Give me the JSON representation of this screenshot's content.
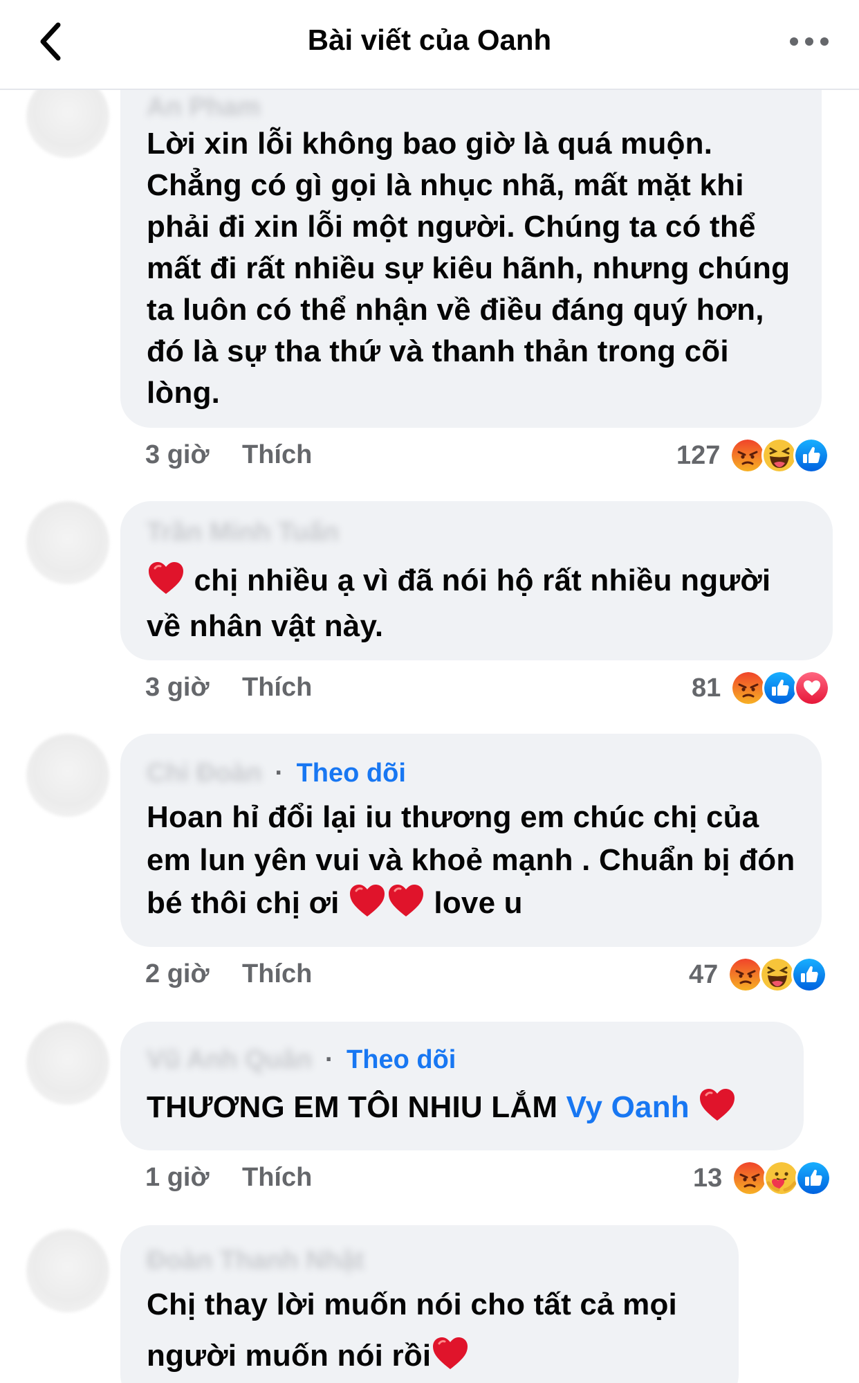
{
  "header": {
    "title": "Bài viết của Oanh"
  },
  "colors": {
    "link_blue": "#1877f2",
    "bubble_bg": "#f0f2f5",
    "meta_gray": "#65676b"
  },
  "comments": [
    {
      "author": "An Pham",
      "text": "Lời xin lỗi không bao giờ là quá muộn. Chẳng có gì gọi là nhục nhã, mất mặt khi phải đi xin lỗi một người. Chúng ta có thể mất đi rất nhiều sự kiêu hãnh, nhưng chúng ta luôn có thể nhận về điều đáng quý hơn, đó là sự tha thứ và thanh thản trong cõi lòng.",
      "time": "3 giờ",
      "like_label": "Thích",
      "reaction_count": "127",
      "reactions": [
        "angry-icon",
        "haha-icon",
        "like-icon"
      ]
    },
    {
      "author": "Trần Minh Tuấn",
      "text": "chị nhiều ạ vì đã nói hộ rất nhiều người về nhân vật này.",
      "time": "3 giờ",
      "like_label": "Thích",
      "reaction_count": "81",
      "reactions": [
        "angry-icon",
        "like-icon",
        "love-icon"
      ]
    },
    {
      "author": "Chi Đoàn",
      "follow_label": "Theo dõi",
      "text_before": "Hoan hỉ đổi lại iu thương em chúc chị của em lun yên vui và khoẻ mạnh . Chuẩn bị đón bé thôi chị ơi",
      "text_after": "love u",
      "time": "2 giờ",
      "like_label": "Thích",
      "reaction_count": "47",
      "reactions": [
        "angry-icon",
        "haha-icon",
        "like-icon"
      ]
    },
    {
      "author": "Vũ Anh Quân",
      "follow_label": "Theo dõi",
      "text": "THƯƠNG EM TÔI NHIU LẮM",
      "mention": "Vy Oanh",
      "time": "1 giờ",
      "like_label": "Thích",
      "reaction_count": "13",
      "reactions": [
        "angry-icon",
        "care-icon",
        "like-icon"
      ]
    },
    {
      "author": "Đoàn Thanh Nhật",
      "text": "Chị thay lời muốn nói cho tất cả mọi người muốn nói rồi"
    }
  ]
}
